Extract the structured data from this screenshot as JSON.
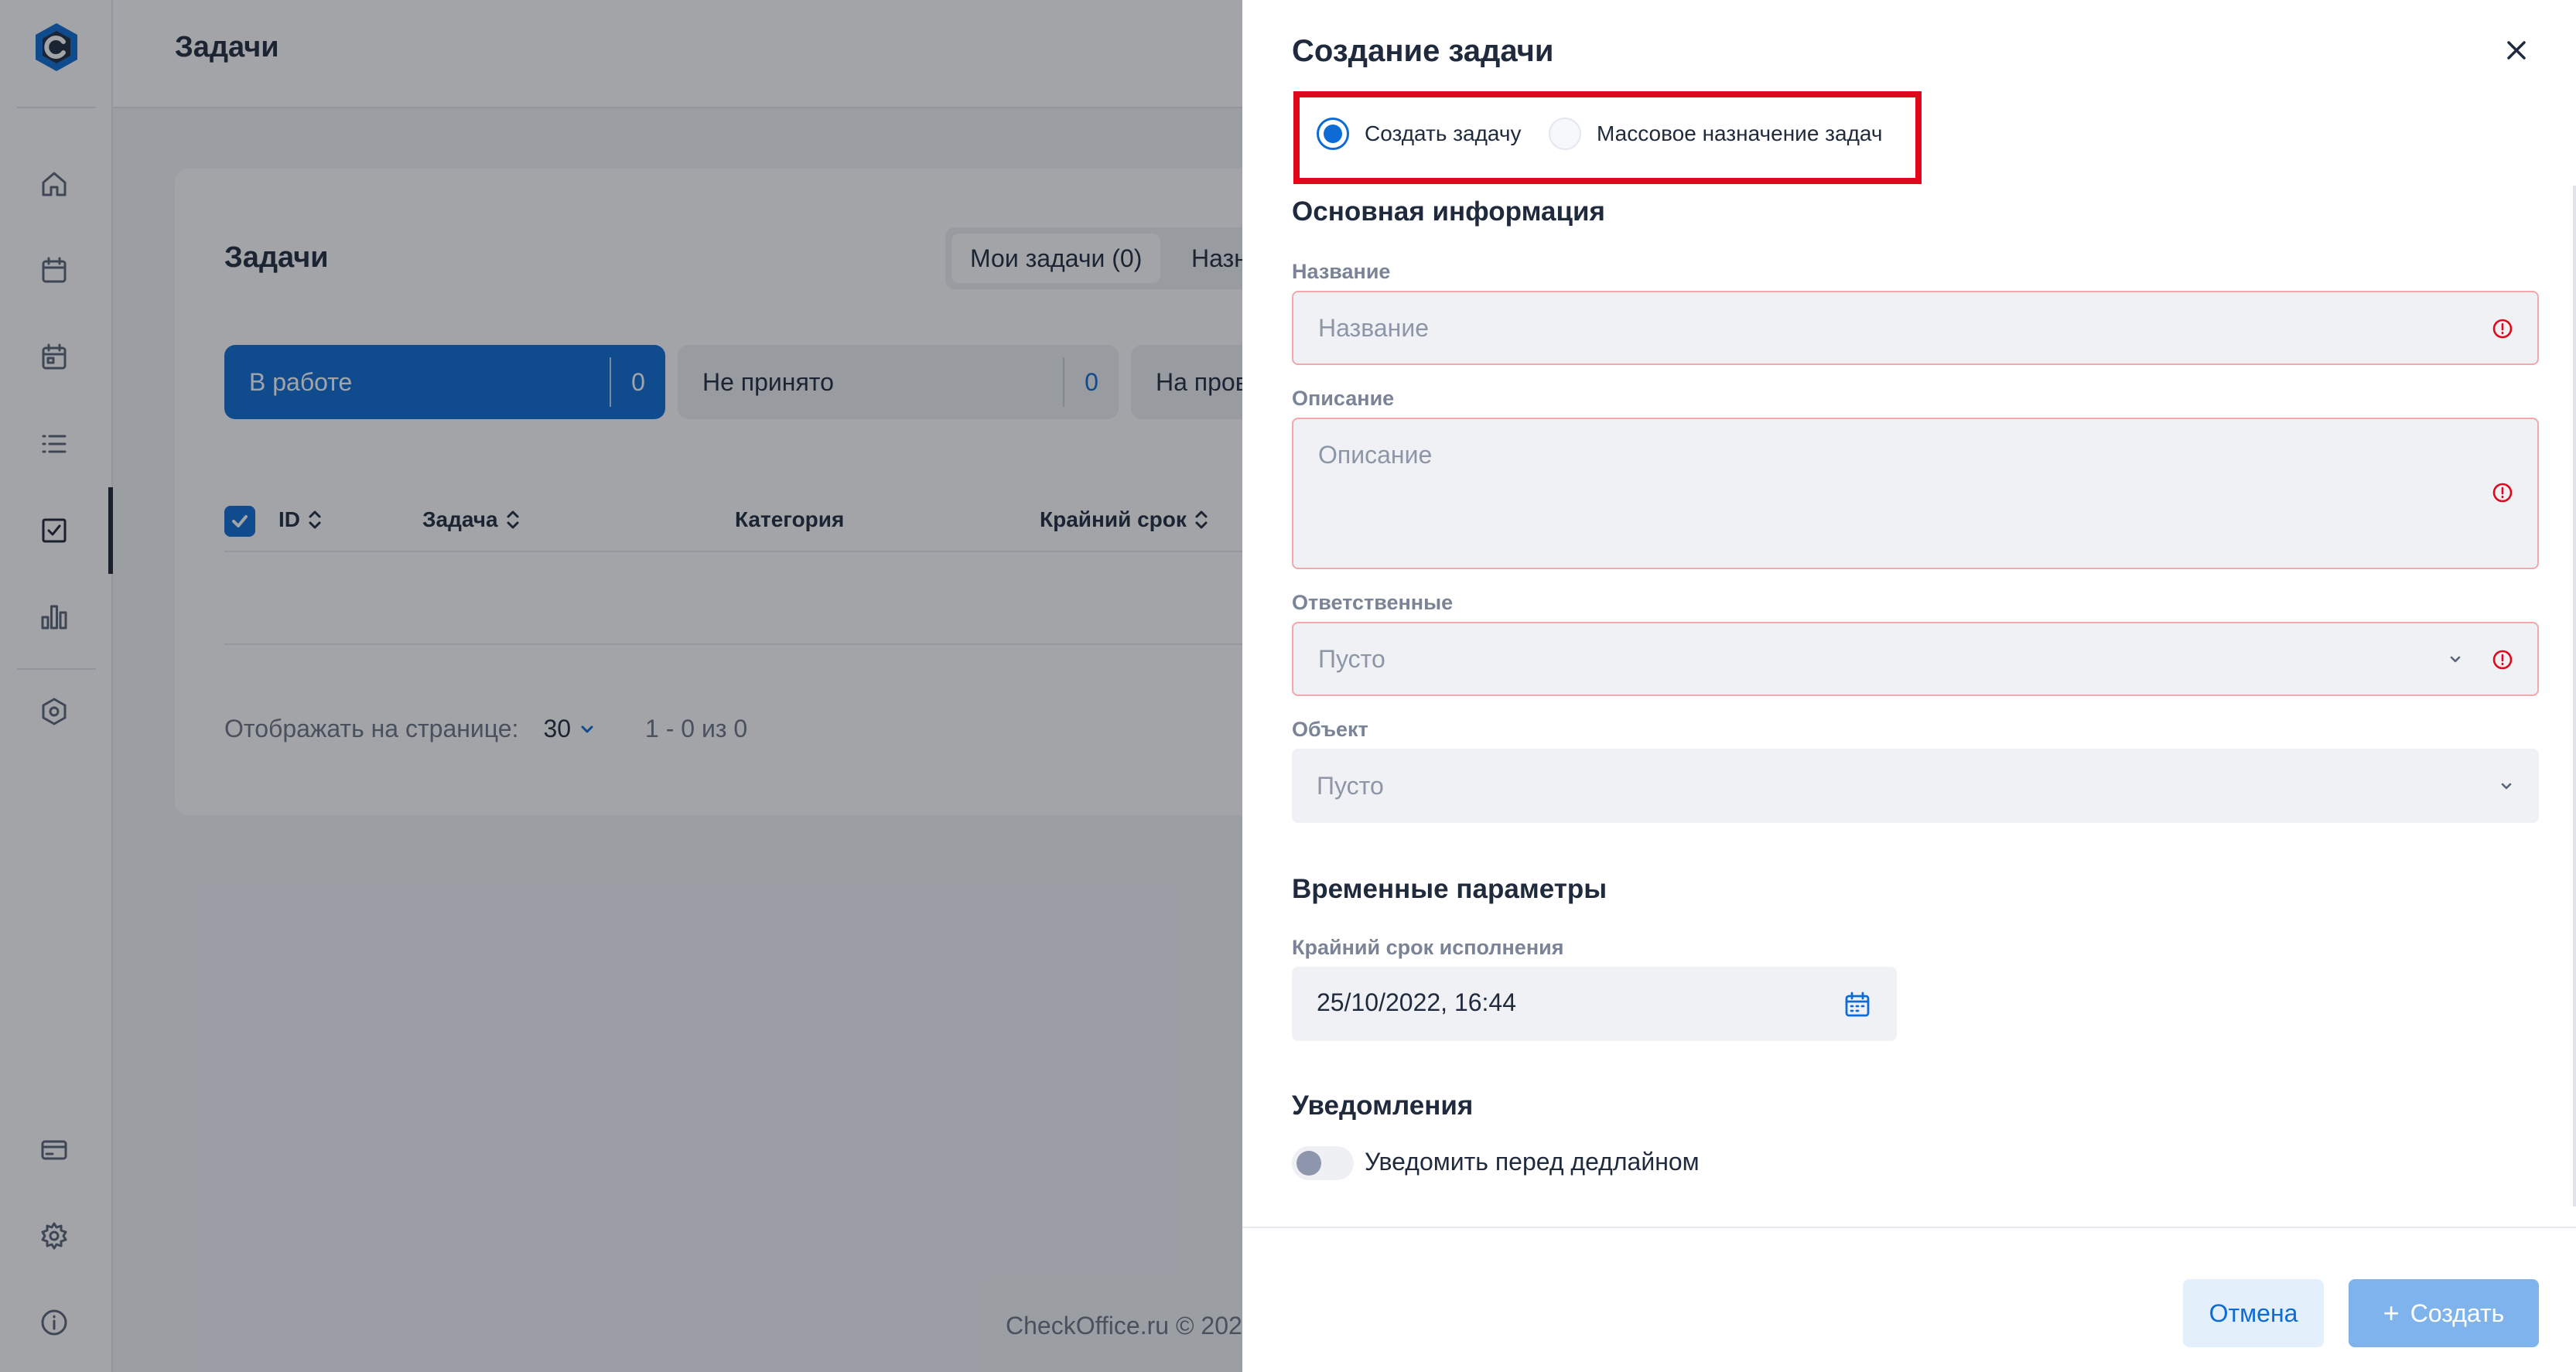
{
  "sidebar": {
    "logo": "checkoffice-logo",
    "items": [
      "home-icon",
      "calendar-icon",
      "calendar-event-icon",
      "list-icon",
      "task-check-icon",
      "bar-chart-icon",
      "hexagon-settings-icon"
    ],
    "bottom_items": [
      "card-icon",
      "gear-icon",
      "info-icon"
    ]
  },
  "main": {
    "header_title": "Задачи",
    "card_title": "Задачи",
    "tabs": {
      "mine": "Мои задачи (0)",
      "next": "Назн"
    },
    "statuses": [
      {
        "label": "В работе",
        "count": "0"
      },
      {
        "label": "Не принято",
        "count": "0"
      },
      {
        "label": "На пров"
      }
    ],
    "table_headers": {
      "id": "ID",
      "task": "Задача",
      "category": "Категория",
      "deadline": "Крайний срок"
    },
    "pager": {
      "label": "Отображать на странице:",
      "value": "30",
      "range": "1 - 0 из 0"
    },
    "footer": "CheckOffice.ru © 202"
  },
  "drawer": {
    "title": "Создание задачи",
    "mode_options": [
      {
        "label": "Создать задачу",
        "selected": true
      },
      {
        "label": "Массовое назначение задач",
        "selected": false
      }
    ],
    "section_basic": "Основная информация",
    "name_label": "Название",
    "name_placeholder": "Название",
    "desc_label": "Описание",
    "desc_placeholder": "Описание",
    "assignee_label": "Ответственные",
    "assignee_placeholder": "Пусто",
    "object_label": "Объект",
    "object_placeholder": "Пусто",
    "section_time": "Временные параметры",
    "deadline_label": "Крайний срок исполнения",
    "deadline_value": "25/10/2022, 16:44",
    "section_notify": "Уведомления",
    "notify_label": "Уведомить перед дедлайном",
    "notify_enabled": false,
    "cancel_label": "Отмена",
    "create_label": "Создать"
  },
  "colors": {
    "primary": "#0d6bd6",
    "error": "#e0081a",
    "highlight_box": "#e0081a",
    "create_disabled": "#7fb3ec"
  }
}
